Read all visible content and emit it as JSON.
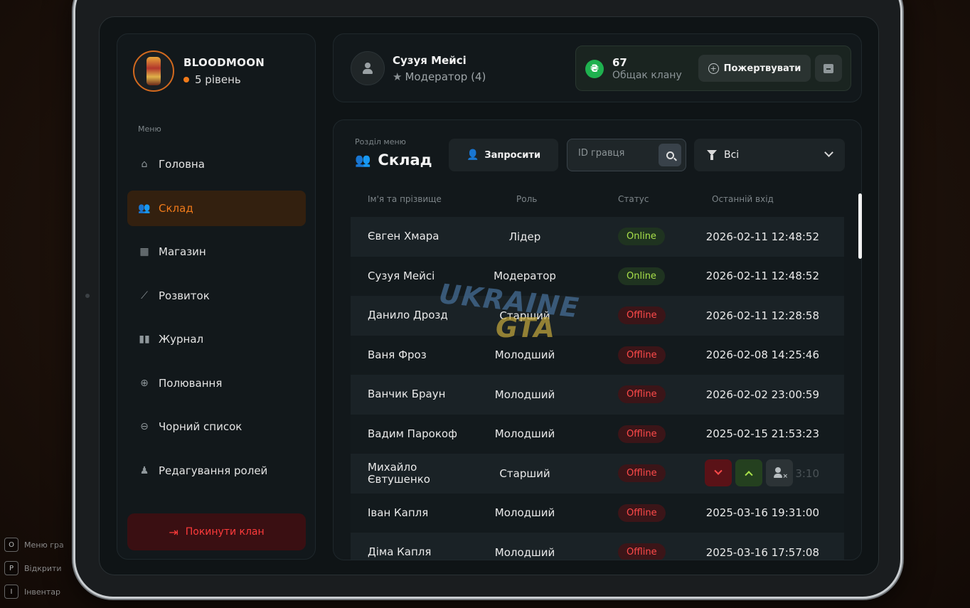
{
  "game_hints": [
    {
      "key": "O",
      "label": "Меню гра"
    },
    {
      "key": "P",
      "label": "Відкрити"
    },
    {
      "key": "I",
      "label": "Інвентар"
    }
  ],
  "clan": {
    "name": "BLOODMOON",
    "level": "5 рівень"
  },
  "sidebar": {
    "caption": "Меню",
    "items": [
      {
        "label": "Головна",
        "icon": "home-icon"
      },
      {
        "label": "Склад",
        "icon": "users-icon",
        "active": true
      },
      {
        "label": "Магазин",
        "icon": "basket-icon"
      },
      {
        "label": "Розвиток",
        "icon": "chart-icon"
      },
      {
        "label": "Журнал",
        "icon": "book-icon"
      },
      {
        "label": "Полювання",
        "icon": "crosshair-icon"
      },
      {
        "label": "Чорний список",
        "icon": "block-icon"
      },
      {
        "label": "Редагування ролей",
        "icon": "user-settings-icon"
      }
    ],
    "leave_label": "Покинути клан"
  },
  "user": {
    "name": "Сузуя Мейсі",
    "role": "Модератор (4)"
  },
  "treasury": {
    "currency_symbol": "₴",
    "amount": "67",
    "label": "Общак клану",
    "donate_label": "Пожертвувати"
  },
  "section": {
    "caption": "Розділ меню",
    "title": "Склад"
  },
  "toolbar": {
    "invite_label": "Запросити",
    "search_placeholder": "ID гравця",
    "filter_value": "Всі"
  },
  "table": {
    "headers": [
      "Ім'я та прізвище",
      "Роль",
      "Статус",
      "Останній вхід"
    ],
    "rows": [
      {
        "name": "Євген Хмара",
        "role": "Лідер",
        "status": "Online",
        "last": "2026-02-11 12:48:52"
      },
      {
        "name": "Сузуя Мейсі",
        "role": "Модератор",
        "status": "Online",
        "last": "2026-02-11 12:48:52"
      },
      {
        "name": "Данило Дрозд",
        "role": "Старший",
        "status": "Offline",
        "last": "2026-02-11 12:28:58"
      },
      {
        "name": "Ваня Фроз",
        "role": "Молодший",
        "status": "Offline",
        "last": "2026-02-08 14:25:46"
      },
      {
        "name": "Ванчик Браун",
        "role": "Молодший",
        "status": "Offline",
        "last": "2026-02-02 23:00:59"
      },
      {
        "name": "Вадим Парокоф",
        "role": "Молодший",
        "status": "Offline",
        "last": "2025-02-15 21:53:23"
      },
      {
        "name": "Михайло Євтушенко",
        "role": "Старший",
        "status": "Offline",
        "last": "3:10"
      },
      {
        "name": "Іван Капля",
        "role": "Молодший",
        "status": "Offline",
        "last": "2025-03-16 19:31:00"
      },
      {
        "name": "Діма Капля",
        "role": "Молодший",
        "status": "Offline",
        "last": "2025-03-16 17:57:08"
      }
    ]
  },
  "watermark": {
    "line1": "UKRAINE",
    "line2": "GTA"
  },
  "colors": {
    "accent": "#f07a1a",
    "online": "#a8e04a",
    "offline": "#ff4a4a",
    "danger": "#ff3b3b",
    "coin": "#1fb14f"
  }
}
